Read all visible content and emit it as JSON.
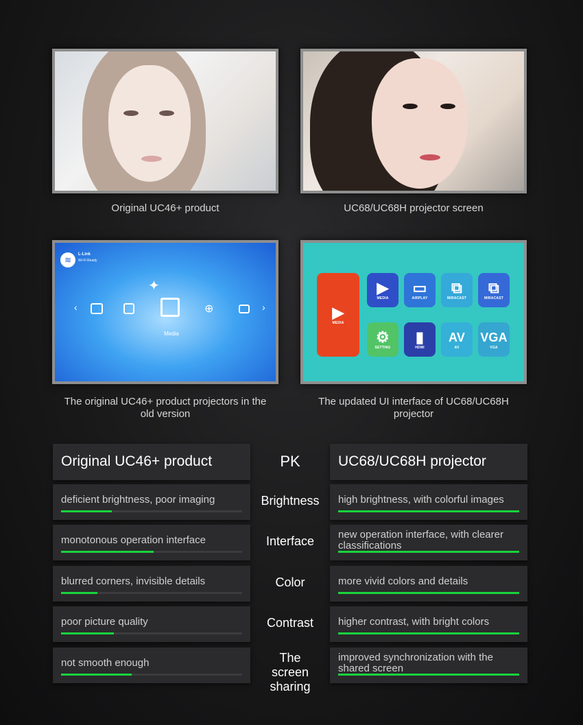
{
  "captions": {
    "photo_old": "Original UC46+ product",
    "photo_new": "UC68/UC68H projector screen",
    "ui_old": "The original UC46+ product projectors in the old version",
    "ui_new": "The updated UI interface of UC68/UC68H projector"
  },
  "old_ui": {
    "brand": "L-Link",
    "wifi": "Wi-Fi Ready",
    "selected_label": "Media"
  },
  "new_ui": {
    "tiles": [
      {
        "label": "MEDIA",
        "glyph": "▶",
        "color": "#e84420"
      },
      {
        "label": "MEDIA",
        "glyph": "▶",
        "color": "#2f4fc8"
      },
      {
        "label": "AIRPLAY",
        "glyph": "▭",
        "color": "#2f74d8"
      },
      {
        "label": "MIRACAST",
        "glyph": "⧉",
        "color": "#35a9d8"
      },
      {
        "label": "MIRACAST",
        "glyph": "⧉",
        "color": "#3569d8"
      },
      {
        "label": "SETTING",
        "glyph": "⚙",
        "color": "#52c466"
      },
      {
        "label": "HDMI",
        "glyph": "▮",
        "color": "#2b3fa8"
      },
      {
        "label": "AV",
        "glyph": "AV",
        "color": "#35b0d8"
      },
      {
        "label": "VGA",
        "glyph": "VGA",
        "color": "#35a6d0"
      }
    ]
  },
  "comparison": {
    "left_title": "Original UC46+ product",
    "center_title": "PK",
    "right_title": "UC68/UC68H projector",
    "accent": "#19d43c",
    "rows": [
      {
        "feature": "Brightness",
        "left": "deficient brightness, poor imaging",
        "left_level": 0.28,
        "right": "high brightness, with colorful images",
        "right_level": 1.0
      },
      {
        "feature": "Interface",
        "left": "monotonous operation interface",
        "left_level": 0.51,
        "right": "new operation interface, with clearer classifications",
        "right_level": 1.0
      },
      {
        "feature": "Color",
        "left": "blurred corners, invisible details",
        "left_level": 0.2,
        "right": "more vivid colors and details",
        "right_level": 1.0
      },
      {
        "feature": "Contrast",
        "left": "poor picture quality",
        "left_level": 0.29,
        "right": "higher contrast, with bright colors",
        "right_level": 1.0
      },
      {
        "feature": "The screen sharing",
        "left": "not smooth enough",
        "left_level": 0.39,
        "right": "improved synchronization with the shared screen",
        "right_level": 1.0
      }
    ]
  }
}
